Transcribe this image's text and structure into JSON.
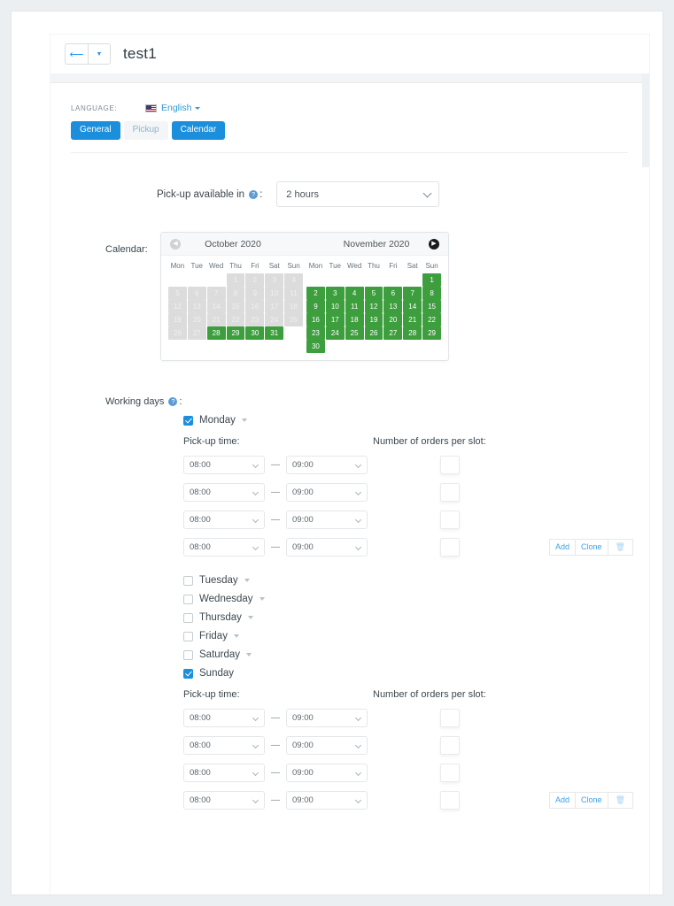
{
  "header": {
    "back_icon": "arrow-left-icon",
    "dropdown_icon": "caret-down-icon",
    "title": "test1"
  },
  "language": {
    "label": "LANGUAGE:",
    "flag_icon": "us-flag-icon",
    "value": "English",
    "caret_icon": "caret-down-icon"
  },
  "tabs": [
    {
      "label": "General",
      "active": true
    },
    {
      "label": "Pickup",
      "active": false
    },
    {
      "label": "Calendar",
      "active": true
    }
  ],
  "pickup_available": {
    "label": "Pick-up available in",
    "help_icon": "question-mark-icon",
    "colon": ":",
    "value": "2 hours",
    "chevron_icon": "chevron-down-icon"
  },
  "calendar": {
    "label": "Calendar:",
    "prev_icon": "prev-month-arrow-icon",
    "next_icon": "next-month-arrow-icon",
    "dow": [
      "Mon",
      "Tue",
      "Wed",
      "Thu",
      "Fri",
      "Sat",
      "Sun"
    ],
    "months": [
      {
        "title": "October 2020",
        "weeks": [
          [
            {
              "d": "",
              "state": "empty"
            },
            {
              "d": "",
              "state": "empty"
            },
            {
              "d": "",
              "state": "empty"
            },
            {
              "d": "1",
              "state": "disabled"
            },
            {
              "d": "2",
              "state": "disabled"
            },
            {
              "d": "3",
              "state": "disabled"
            },
            {
              "d": "4",
              "state": "disabled"
            }
          ],
          [
            {
              "d": "5",
              "state": "disabled"
            },
            {
              "d": "6",
              "state": "disabled"
            },
            {
              "d": "7",
              "state": "disabled"
            },
            {
              "d": "8",
              "state": "disabled"
            },
            {
              "d": "9",
              "state": "disabled"
            },
            {
              "d": "10",
              "state": "disabled"
            },
            {
              "d": "11",
              "state": "disabled"
            }
          ],
          [
            {
              "d": "12",
              "state": "disabled"
            },
            {
              "d": "13",
              "state": "disabled"
            },
            {
              "d": "14",
              "state": "disabled"
            },
            {
              "d": "15",
              "state": "disabled"
            },
            {
              "d": "16",
              "state": "disabled"
            },
            {
              "d": "17",
              "state": "disabled"
            },
            {
              "d": "18",
              "state": "disabled"
            }
          ],
          [
            {
              "d": "19",
              "state": "disabled"
            },
            {
              "d": "20",
              "state": "disabled"
            },
            {
              "d": "21",
              "state": "disabled"
            },
            {
              "d": "22",
              "state": "disabled"
            },
            {
              "d": "23",
              "state": "disabled"
            },
            {
              "d": "24",
              "state": "disabled"
            },
            {
              "d": "25",
              "state": "disabled"
            }
          ],
          [
            {
              "d": "26",
              "state": "disabled"
            },
            {
              "d": "27",
              "state": "disabled"
            },
            {
              "d": "28",
              "state": "selected"
            },
            {
              "d": "29",
              "state": "selected"
            },
            {
              "d": "30",
              "state": "selected"
            },
            {
              "d": "31",
              "state": "selected"
            },
            {
              "d": "",
              "state": "empty"
            }
          ]
        ]
      },
      {
        "title": "November 2020",
        "weeks": [
          [
            {
              "d": "",
              "state": "empty"
            },
            {
              "d": "",
              "state": "empty"
            },
            {
              "d": "",
              "state": "empty"
            },
            {
              "d": "",
              "state": "empty"
            },
            {
              "d": "",
              "state": "empty"
            },
            {
              "d": "",
              "state": "empty"
            },
            {
              "d": "1",
              "state": "selected"
            }
          ],
          [
            {
              "d": "2",
              "state": "selected"
            },
            {
              "d": "3",
              "state": "selected"
            },
            {
              "d": "4",
              "state": "selected"
            },
            {
              "d": "5",
              "state": "selected"
            },
            {
              "d": "6",
              "state": "selected"
            },
            {
              "d": "7",
              "state": "selected"
            },
            {
              "d": "8",
              "state": "selected"
            }
          ],
          [
            {
              "d": "9",
              "state": "selected"
            },
            {
              "d": "10",
              "state": "selected"
            },
            {
              "d": "11",
              "state": "selected"
            },
            {
              "d": "12",
              "state": "selected"
            },
            {
              "d": "13",
              "state": "selected"
            },
            {
              "d": "14",
              "state": "selected"
            },
            {
              "d": "15",
              "state": "selected"
            }
          ],
          [
            {
              "d": "16",
              "state": "selected"
            },
            {
              "d": "17",
              "state": "selected"
            },
            {
              "d": "18",
              "state": "selected"
            },
            {
              "d": "19",
              "state": "selected"
            },
            {
              "d": "20",
              "state": "selected"
            },
            {
              "d": "21",
              "state": "selected"
            },
            {
              "d": "22",
              "state": "selected"
            }
          ],
          [
            {
              "d": "23",
              "state": "selected"
            },
            {
              "d": "24",
              "state": "selected"
            },
            {
              "d": "25",
              "state": "selected"
            },
            {
              "d": "26",
              "state": "selected"
            },
            {
              "d": "27",
              "state": "selected"
            },
            {
              "d": "28",
              "state": "selected"
            },
            {
              "d": "29",
              "state": "selected"
            }
          ],
          [
            {
              "d": "30",
              "state": "selected"
            },
            {
              "d": "",
              "state": "empty"
            },
            {
              "d": "",
              "state": "empty"
            },
            {
              "d": "",
              "state": "empty"
            },
            {
              "d": "",
              "state": "empty"
            },
            {
              "d": "",
              "state": "empty"
            },
            {
              "d": "",
              "state": "empty"
            }
          ]
        ]
      }
    ]
  },
  "working_days": {
    "label": "Working days",
    "help_icon": "question-mark-icon",
    "colon": ":",
    "days": [
      {
        "name": "Monday",
        "checked": true,
        "has_caret": true
      },
      {
        "name": "Tuesday",
        "checked": false,
        "has_caret": true
      },
      {
        "name": "Wednesday",
        "checked": false,
        "has_caret": true
      },
      {
        "name": "Thursday",
        "checked": false,
        "has_caret": true
      },
      {
        "name": "Friday",
        "checked": false,
        "has_caret": true
      },
      {
        "name": "Saturday",
        "checked": false,
        "has_caret": true
      },
      {
        "name": "Sunday",
        "checked": true,
        "has_caret": false
      }
    ]
  },
  "slots_section": {
    "pickup_time_label": "Pick-up time:",
    "orders_label": "Number of orders per slot:",
    "rows": [
      {
        "from": "08:00",
        "to": "09:00",
        "orders": ""
      },
      {
        "from": "08:00",
        "to": "09:00",
        "orders": ""
      },
      {
        "from": "08:00",
        "to": "09:00",
        "orders": ""
      },
      {
        "from": "08:00",
        "to": "09:00",
        "orders": ""
      }
    ],
    "dash": "—",
    "actions": {
      "add": "Add",
      "clone": "Clone",
      "delete_icon": "trash-icon"
    }
  },
  "colors": {
    "accent_blue": "#1b8fdb",
    "selected_green": "#3d9e3d",
    "disabled_gray": "#dcdcdc",
    "link_blue": "#3fa0e8"
  }
}
